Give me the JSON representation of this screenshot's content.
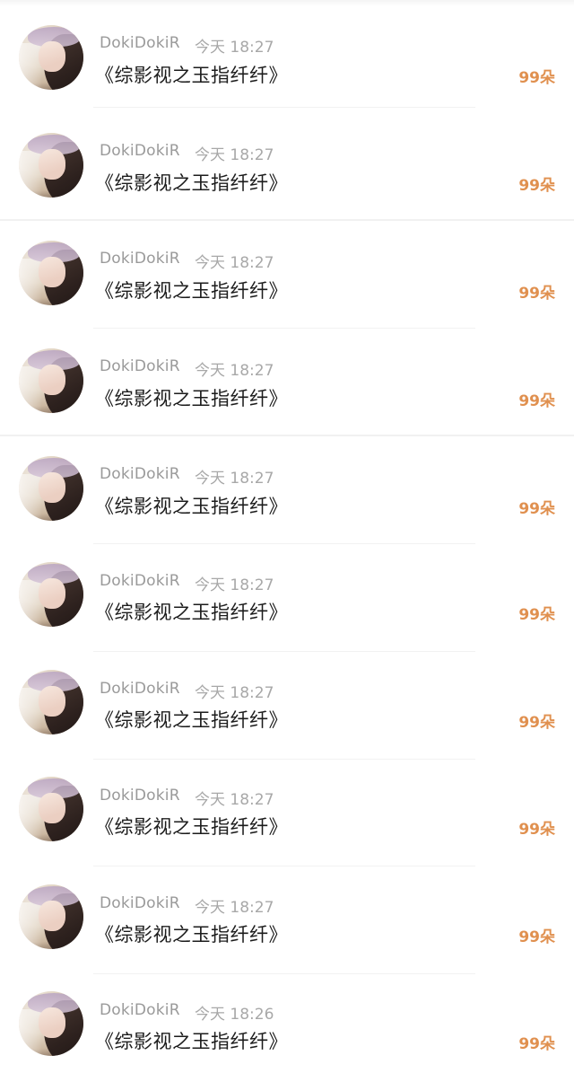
{
  "items": [
    {
      "username": "DokiDokiR",
      "time": "今天 18:27",
      "title": "《综影视之玉指纤纤》",
      "count": "99朵"
    },
    {
      "username": "DokiDokiR",
      "time": "今天 18:27",
      "title": "《综影视之玉指纤纤》",
      "count": "99朵"
    },
    {
      "username": "DokiDokiR",
      "time": "今天 18:27",
      "title": "《综影视之玉指纤纤》",
      "count": "99朵"
    },
    {
      "username": "DokiDokiR",
      "time": "今天 18:27",
      "title": "《综影视之玉指纤纤》",
      "count": "99朵"
    },
    {
      "username": "DokiDokiR",
      "time": "今天 18:27",
      "title": "《综影视之玉指纤纤》",
      "count": "99朵"
    },
    {
      "username": "DokiDokiR",
      "time": "今天 18:27",
      "title": "《综影视之玉指纤纤》",
      "count": "99朵"
    },
    {
      "username": "DokiDokiR",
      "time": "今天 18:27",
      "title": "《综影视之玉指纤纤》",
      "count": "99朵"
    },
    {
      "username": "DokiDokiR",
      "time": "今天 18:27",
      "title": "《综影视之玉指纤纤》",
      "count": "99朵"
    },
    {
      "username": "DokiDokiR",
      "time": "今天 18:27",
      "title": "《综影视之玉指纤纤》",
      "count": "99朵"
    },
    {
      "username": "DokiDokiR",
      "time": "今天 18:26",
      "title": "《综影视之玉指纤纤》",
      "count": "99朵"
    }
  ]
}
